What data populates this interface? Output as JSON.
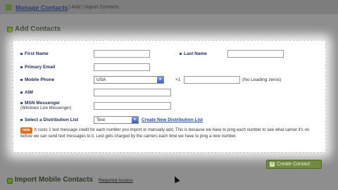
{
  "breadcrumb": {
    "main": "Manage Contacts",
    "sub": "| Add | Import Contacts"
  },
  "add_section": {
    "title": "Add Contacts"
  },
  "form": {
    "first_name_label": "First Name",
    "last_name_label": "Last Name",
    "primary_email_label": "Primary Email",
    "mobile_phone_label": "Mobile Phone",
    "country_value": "USA",
    "country_code": "+1",
    "phone_hint": "(No Leading zeros)",
    "aim_label": "AIM",
    "msn_label": "MSN Messenger",
    "msn_sub": "(Windows Live Messenger)",
    "distribution_label": "Select a Distribution List",
    "distribution_value": "Test",
    "create_list_link": "Create New Distribution List",
    "note_badge": "note",
    "note_text": "It costs 1 text message credit for each number you import or manually add. This is because we have to ping each number to see what carrier it's on before we can send text messages to it. Lest gets charged by the carriers each time we have to ping a new number."
  },
  "create_button": {
    "label": "Create Contact"
  },
  "import_section": {
    "title": "Import Mobile Contacts",
    "link": "Required Access"
  }
}
